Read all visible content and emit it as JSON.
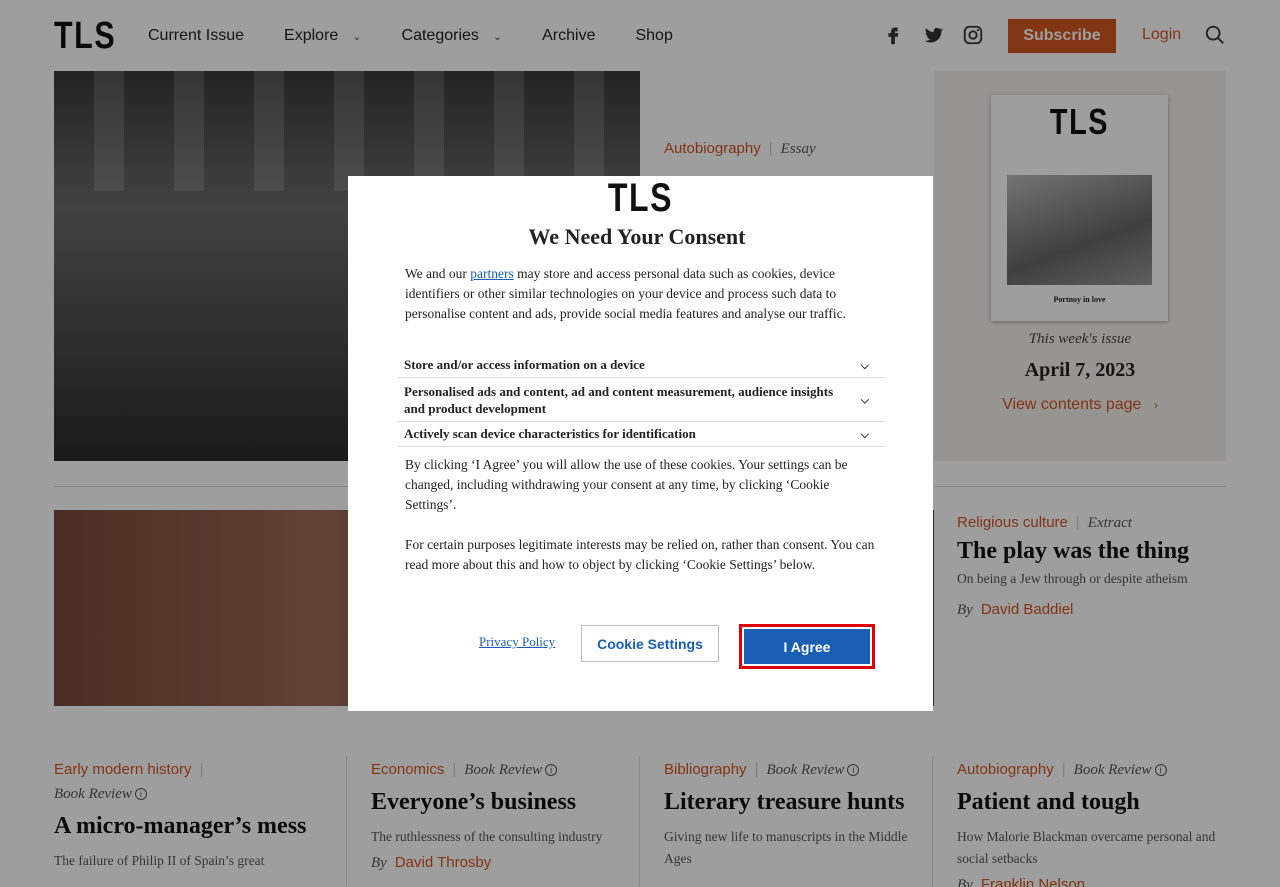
{
  "header": {
    "logo": "TLS",
    "nav": [
      {
        "label": "Current Issue",
        "dropdown": false
      },
      {
        "label": "Explore",
        "dropdown": true
      },
      {
        "label": "Categories",
        "dropdown": true
      },
      {
        "label": "Archive",
        "dropdown": false
      },
      {
        "label": "Shop",
        "dropdown": false
      }
    ],
    "social_icons": [
      "facebook-icon",
      "twitter-icon",
      "instagram-icon"
    ],
    "subscribe_label": "Subscribe",
    "login_label": "Login",
    "accent": "#d4541e"
  },
  "hero": {
    "category": "Autobiography",
    "type": "Essay"
  },
  "issue": {
    "cover_logo": "TLS",
    "cover_caption": "Portnoy in love",
    "label": "This week's issue",
    "date": "April 7, 2023",
    "link": "View contents page"
  },
  "feature2": {
    "category": "Religious culture",
    "type": "Extract",
    "title": "The play was the thing",
    "standfirst": "On being a Jew through or despite atheism",
    "by": "By",
    "author": "David Baddiel"
  },
  "articles": [
    {
      "category": "Early modern history",
      "type": "Book Review",
      "title": "A micro-manager’s mess",
      "standfirst": "The failure of Philip II of Spain’s great"
    },
    {
      "category": "Economics",
      "type": "Book Review",
      "title": "Everyone’s business",
      "standfirst": "The ruthlessness of the consulting industry",
      "by": "By",
      "author": "David Throsby"
    },
    {
      "category": "Bibliography",
      "type": "Book Review",
      "title": "Literary treasure hunts",
      "standfirst": "Giving new life to manuscripts in the Middle Ages"
    },
    {
      "category": "Autobiography",
      "type": "Book Review",
      "title": "Patient and tough",
      "standfirst": "How Malorie Blackman overcame personal and social setbacks",
      "by": "By",
      "author": "Franklin Nelson"
    }
  ],
  "consent": {
    "logo": "TLS",
    "title": "We Need Your Consent",
    "intro_before": "We and our ",
    "intro_link": "partners",
    "intro_after": " may store and access personal data such as cookies, device identifiers or other similar technologies on your device and process such data to personalise content and ads, provide social media features and analyse our traffic.",
    "purposes": [
      "Store and/or access information on a device",
      "Personalised ads and content, ad and content measurement, audience insights and product development",
      "Actively scan device characteristics for identification"
    ],
    "agree_text": "By clicking ‘I Agree’ you will allow the use of these cookies. Your settings can be changed, including withdrawing your consent at any time, by clicking ‘Cookie Settings’.",
    "legit_text": "For certain purposes legitimate interests may be relied on, rather than consent. You can read more about this and how to object by clicking ‘Cookie Settings’ below.",
    "privacy_link": "Privacy Policy",
    "settings_button": "Cookie Settings",
    "agree_button": "I Agree"
  }
}
